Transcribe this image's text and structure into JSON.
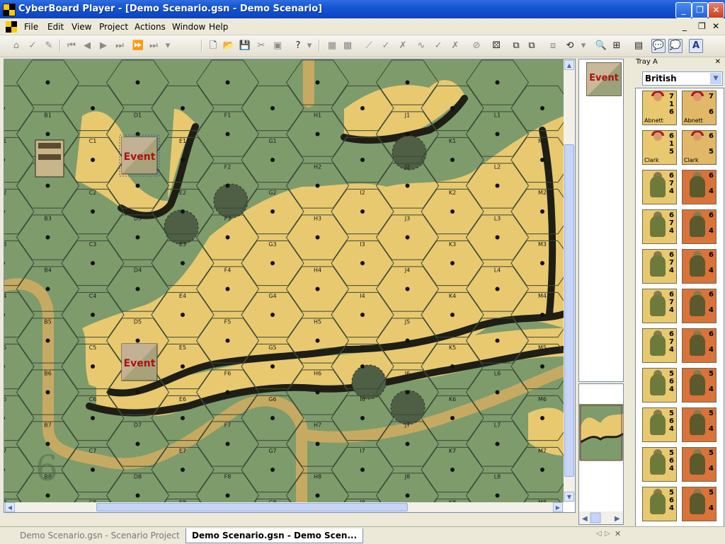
{
  "window": {
    "title": "CyberBoard Player - [Demo Scenario.gsn - Demo Scenario]",
    "controls": {
      "minimize": "_",
      "restore": "❐",
      "close": "✕"
    }
  },
  "menu": {
    "items": [
      "File",
      "Edit",
      "View",
      "Project",
      "Actions",
      "Window",
      "Help"
    ],
    "mdi": {
      "minimize": "_",
      "restore": "❐",
      "close": "✕"
    }
  },
  "map": {
    "cols": [
      "A",
      "B",
      "C",
      "D",
      "E",
      "F",
      "G",
      "H",
      "I",
      "J",
      "K",
      "L",
      "M"
    ],
    "rows": 8,
    "event_label": "Event",
    "board_number": "6",
    "colors": {
      "grass": "#7e9b6c",
      "grid": "#3a4a38",
      "hill": "#e9c96f",
      "shadow": "#1e1e16",
      "road": "#c7aa62"
    }
  },
  "preview": {
    "event_label": "Event"
  },
  "tray": {
    "title": "Tray A",
    "close": "✕",
    "selected": "British",
    "units": [
      {
        "name": "Abnett",
        "a": "7",
        "b": "1",
        "c": "6",
        "type": "leader"
      },
      {
        "name": "Clark",
        "a": "6",
        "b": "1",
        "c": "5",
        "type": "leader"
      },
      {
        "name": "",
        "a": "6",
        "b": "7",
        "c": "4",
        "type": "squad"
      },
      {
        "name": "",
        "a": "6",
        "b": "7",
        "c": "4",
        "type": "squad"
      },
      {
        "name": "",
        "a": "6",
        "b": "7",
        "c": "4",
        "type": "squad"
      },
      {
        "name": "",
        "a": "6",
        "b": "7",
        "c": "4",
        "type": "squad"
      },
      {
        "name": "",
        "a": "6",
        "b": "7",
        "c": "4",
        "type": "squad"
      },
      {
        "name": "",
        "a": "5",
        "b": "6",
        "c": "4",
        "type": "half"
      },
      {
        "name": "",
        "a": "5",
        "b": "6",
        "c": "4",
        "type": "half"
      },
      {
        "name": "",
        "a": "5",
        "b": "6",
        "c": "4",
        "type": "half"
      },
      {
        "name": "",
        "a": "5",
        "b": "6",
        "c": "4",
        "type": "half"
      }
    ],
    "broken_labels": {
      "left_a": "5",
      "mid": "2"
    }
  },
  "tabs": [
    "Demo Scenario.gsn - Scenario Project",
    "Demo Scenario.gsn - Demo Scen..."
  ],
  "tab_nav": {
    "prev": "◁",
    "next": "▷",
    "close": "✕"
  }
}
